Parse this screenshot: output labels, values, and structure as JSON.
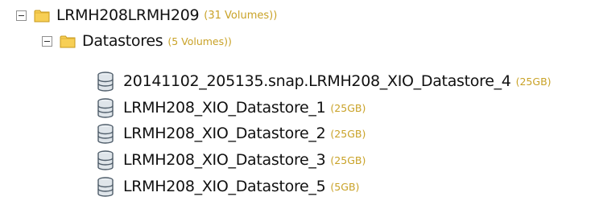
{
  "tree": {
    "root": {
      "name": "LRMH208LRMH209",
      "count": "(31 Volumes))"
    },
    "datastores": {
      "name": "Datastores",
      "count": "(5 Volumes))"
    },
    "volumes": [
      {
        "name": "20141102_205135.snap.LRMH208_XIO_Datastore_4",
        "size": "(25GB)"
      },
      {
        "name": "LRMH208_XIO_Datastore_1",
        "size": "(25GB)"
      },
      {
        "name": "LRMH208_XIO_Datastore_2",
        "size": "(25GB)"
      },
      {
        "name": "LRMH208_XIO_Datastore_3",
        "size": "(25GB)"
      },
      {
        "name": "LRMH208_XIO_Datastore_5",
        "size": "(5GB)"
      }
    ]
  },
  "colors": {
    "count_text": "#c9a227",
    "folder_fill": "#f5c542",
    "database_icon": "#5a6b7a"
  },
  "icons": {
    "expander": "minus-square-icon",
    "folder": "folder-icon",
    "volume": "database-icon"
  }
}
